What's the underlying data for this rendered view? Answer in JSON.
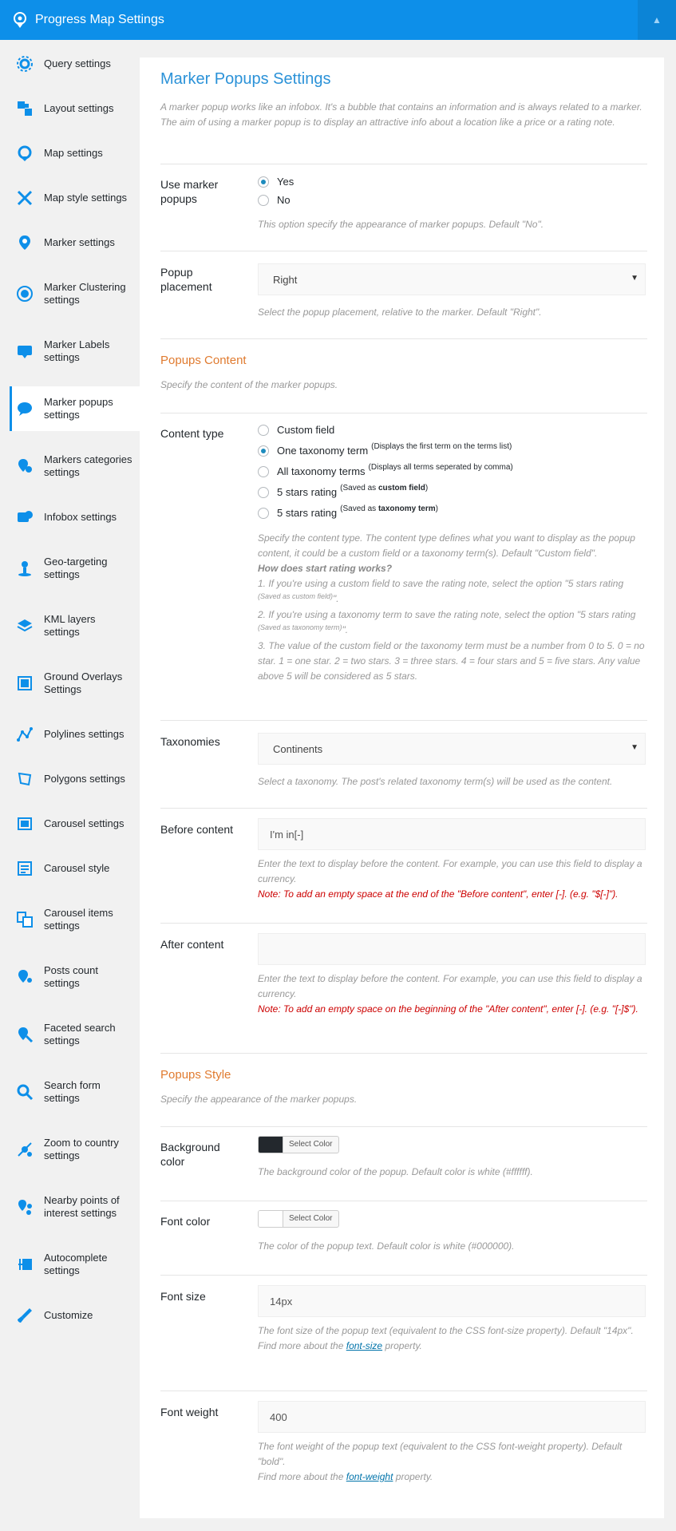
{
  "header": {
    "title": "Progress Map Settings",
    "collapse_icon": "chevron-up-icon"
  },
  "sidebar": {
    "items": [
      {
        "label": "Query settings",
        "icon": "gear-icon",
        "active": false
      },
      {
        "label": "Layout settings",
        "icon": "layout-icon",
        "active": false
      },
      {
        "label": "Map settings",
        "icon": "map-gear-icon",
        "active": false
      },
      {
        "label": "Map style settings",
        "icon": "map-style-icon",
        "active": false
      },
      {
        "label": "Marker settings",
        "icon": "marker-icon",
        "active": false
      },
      {
        "label": "Marker Clustering settings",
        "icon": "cluster-icon",
        "active": false
      },
      {
        "label": "Marker Labels settings",
        "icon": "marker-label-icon",
        "active": false
      },
      {
        "label": "Marker popups settings",
        "icon": "popup-icon",
        "active": true
      },
      {
        "label": "Markers categories settings",
        "icon": "marker-category-icon",
        "active": false
      },
      {
        "label": "Infobox settings",
        "icon": "infobox-icon",
        "active": false
      },
      {
        "label": "Geo-targeting settings",
        "icon": "geo-target-icon",
        "active": false
      },
      {
        "label": "KML layers settings",
        "icon": "layers-icon",
        "active": false
      },
      {
        "label": "Ground Overlays Settings",
        "icon": "ground-overlay-icon",
        "active": false
      },
      {
        "label": "Polylines settings",
        "icon": "polyline-icon",
        "active": false
      },
      {
        "label": "Polygons settings",
        "icon": "polygon-icon",
        "active": false
      },
      {
        "label": "Carousel settings",
        "icon": "carousel-icon",
        "active": false
      },
      {
        "label": "Carousel style",
        "icon": "carousel-style-icon",
        "active": false
      },
      {
        "label": "Carousel items settings",
        "icon": "carousel-items-icon",
        "active": false
      },
      {
        "label": "Posts count settings",
        "icon": "posts-count-icon",
        "active": false
      },
      {
        "label": "Faceted search settings",
        "icon": "faceted-search-icon",
        "active": false
      },
      {
        "label": "Search form settings",
        "icon": "search-icon",
        "active": false
      },
      {
        "label": "Zoom to country settings",
        "icon": "zoom-country-icon",
        "active": false
      },
      {
        "label": "Nearby points of interest settings",
        "icon": "nearby-poi-icon",
        "active": false
      },
      {
        "label": "Autocomplete settings",
        "icon": "autocomplete-icon",
        "active": false
      },
      {
        "label": "Customize",
        "icon": "brush-icon",
        "active": false
      }
    ]
  },
  "main": {
    "title": "Marker Popups Settings",
    "intro": "A marker popup works like an infobox. It's a bubble that contains an information and is always related to a marker. The aim of using a marker popup is to display an attractive info about a location like a price or a rating note.",
    "use_popups": {
      "label": "Use marker popups",
      "options": [
        "Yes",
        "No"
      ],
      "selected": "Yes",
      "desc": "This option specify the appearance of marker popups. Default \"No\"."
    },
    "placement": {
      "label": "Popup placement",
      "value": "Right",
      "desc": "Select the popup placement, relative to the marker. Default \"Right\"."
    },
    "popups_content": {
      "heading": "Popups Content",
      "subheading": "Specify the content of the marker popups."
    },
    "content_type": {
      "label": "Content type",
      "options": [
        {
          "label": "Custom field",
          "note": "",
          "selected": false
        },
        {
          "label": "One taxonomy term",
          "note": "(Displays the first term on the terms list)",
          "selected": true
        },
        {
          "label": "All taxonomy terms",
          "note": "(Displays all terms seperated by comma)",
          "selected": false
        },
        {
          "label": "5 stars rating",
          "note_pre": "(Saved as ",
          "note_bold": "custom field",
          "note_post": ")",
          "selected": false
        },
        {
          "label": "5 stars rating",
          "note_pre": "(Saved as ",
          "note_bold": "taxonomy term",
          "note_post": ")",
          "selected": false
        }
      ],
      "desc_main": "Specify the content type. The content type defines what you want to display as the popup content, it could be a custom field or a taxonomy term(s). Default \"Custom field\".",
      "desc_heading": "How does start rating works?",
      "desc_1": "1. If you're using a custom field to save the rating note, select the option \"5 stars rating",
      "desc_1_small": "(Saved as custom field)",
      "desc_1_end": "\".",
      "desc_2": "2. If you're using a taxonomy term to save the rating note, select the option \"5 stars rating",
      "desc_2_small": "(Saved as taxonomy term)",
      "desc_2_end": "\".",
      "desc_3": "3. The value of the custom field or the taxonomy term must be a number from 0 to 5. 0 = no star. 1 = one star. 2 = two stars. 3 = three stars. 4 = four stars and 5 = five stars. Any value above 5 will be considered as 5 stars."
    },
    "taxonomies": {
      "label": "Taxonomies",
      "value": "Continents",
      "desc": "Select a taxonomy. The post's related taxonomy term(s) will be used as the content."
    },
    "before_content": {
      "label": "Before content",
      "value": "I'm in[-]",
      "desc": "Enter the text to display before the content. For example, you can use this field to display a currency.",
      "note": "Note: To add an empty space at the end of the \"Before content\", enter [-]. (e.g. \"$[-]\")."
    },
    "after_content": {
      "label": "After content",
      "value": "",
      "desc": "Enter the text to display before the content. For example, you can use this field to display a currency.",
      "note": "Note: To add an empty space on the beginning of the \"After content\", enter [-]. (e.g. \"[-]$\")."
    },
    "popups_style": {
      "heading": "Popups Style",
      "subheading": "Specify the appearance of the marker popups."
    },
    "bg_color": {
      "label": "Background color",
      "button": "Select Color",
      "swatch": "#23282d",
      "desc": "The background color of the popup. Default color is white (#ffffff)."
    },
    "font_color": {
      "label": "Font color",
      "button": "Select Color",
      "swatch": "#ffffff",
      "desc": "The color of the popup text. Default color is white (#000000)."
    },
    "font_size": {
      "label": "Font size",
      "value": "14px",
      "desc": "The font size of the popup text (equivalent to the CSS font-size property). Default \"14px\".",
      "more_pre": "Find more about the ",
      "more_link": "font-size",
      "more_post": " property."
    },
    "font_weight": {
      "label": "Font weight",
      "value": "400",
      "desc": "The font weight of the popup text (equivalent to the CSS font-weight property). Default \"bold\".",
      "more_pre": "Find more about the ",
      "more_link": "font-weight",
      "more_post": " property."
    }
  },
  "colors": {
    "brand": "#0d8fe9",
    "accent_heading": "#e07b30",
    "title": "#2b92d8",
    "note": "#cc0000"
  }
}
